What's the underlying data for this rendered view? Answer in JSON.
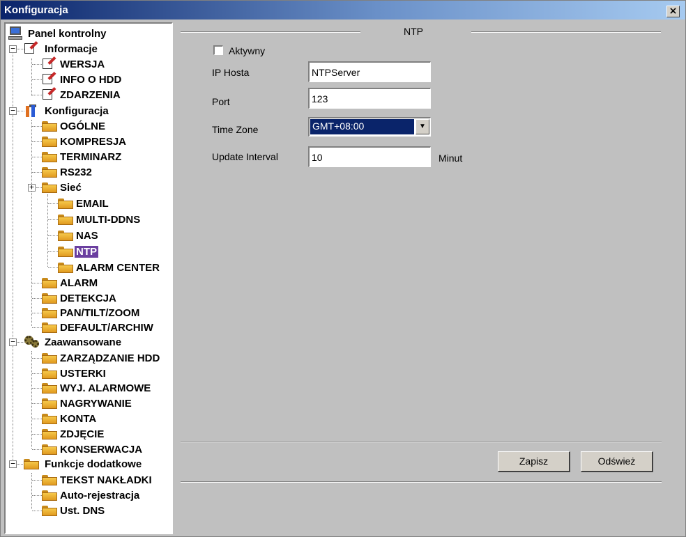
{
  "window": {
    "title": "Konfiguracja",
    "close_glyph": "×"
  },
  "tree": {
    "root": "Panel kontrolny",
    "informacje": {
      "label": "Informacje",
      "expander": "−",
      "items": [
        "WERSJA",
        "INFO O HDD",
        "ZDARZENIA"
      ]
    },
    "konfiguracja": {
      "label": "Konfiguracja",
      "expander": "−",
      "items": [
        "OGÓLNE",
        "KOMPRESJA",
        "TERMINARZ",
        "RS232"
      ]
    },
    "siec": {
      "label": "Sieć",
      "expander": "+",
      "items": [
        "EMAIL",
        "MULTI-DDNS",
        "NAS",
        "NTP",
        "ALARM CENTER"
      ],
      "selected": "NTP"
    },
    "konfiguracja_after": [
      "ALARM",
      "DETEKCJA",
      "PAN/TILT/ZOOM",
      "DEFAULT/ARCHIW"
    ],
    "zaawansowane": {
      "label": "Zaawansowane",
      "expander": "−",
      "items": [
        "ZARZĄDZANIE HDD",
        "USTERKI",
        "WYJ. ALARMOWE",
        "NAGRYWANIE",
        "KONTA",
        "ZDJĘCIE",
        "KONSERWACJA"
      ]
    },
    "funkcje": {
      "label": "Funkcje dodatkowe",
      "expander": "−",
      "items": [
        "TEKST NAKŁADKI",
        "Auto-rejestracja",
        "Ust. DNS"
      ]
    }
  },
  "ntp": {
    "section_title": "NTP",
    "aktywny_label": "Aktywny",
    "aktywny_checked": false,
    "ip_label": "IP Hosta",
    "ip_value": "NTPServer",
    "port_label": "Port",
    "port_value": "123",
    "tz_label": "Time Zone",
    "tz_value": "GMT+08:00",
    "interval_label": "Update Interval",
    "interval_value": "10",
    "interval_unit": "Minut"
  },
  "buttons": {
    "save": "Zapisz",
    "refresh": "Odśwież",
    "dropdown_arrow": "▼"
  }
}
